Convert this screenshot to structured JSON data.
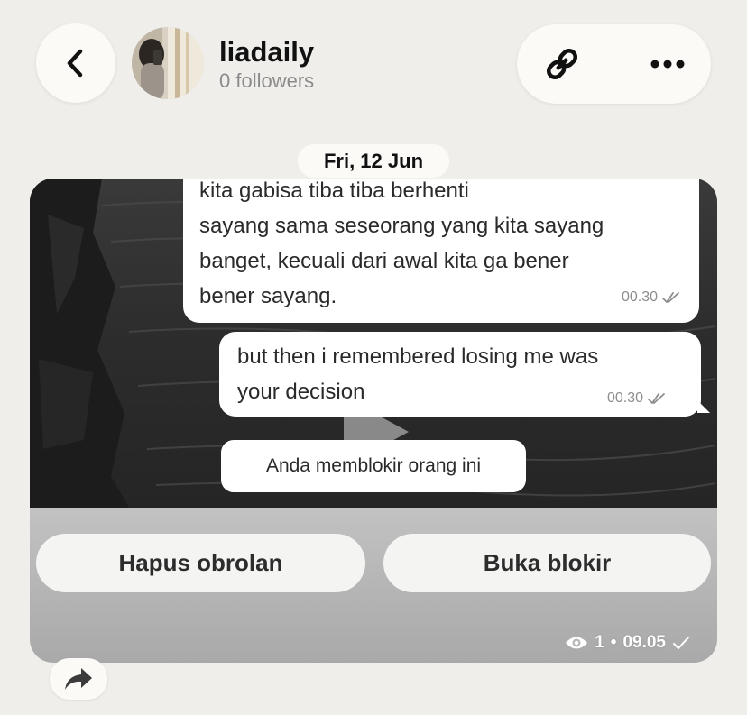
{
  "header": {
    "channel_name": "liadaily",
    "followers": "0 followers"
  },
  "icons": {
    "back": "chevron-left-icon",
    "link": "link-icon",
    "more": "more-horizontal-icon",
    "play": "play-icon",
    "views": "eye-icon",
    "sent": "check-icon",
    "read": "double-check-icon",
    "share": "share-arrow-icon"
  },
  "date_divider": "Fri, 12 Jun",
  "post": {
    "messages": [
      {
        "lines": [
          "kita gabisa tiba tiba berhenti",
          "sayang sama seseorang yang kita sayang",
          "banget, kecuali dari awal kita ga bener",
          "bener sayang."
        ],
        "time": "00.30"
      },
      {
        "lines": [
          "but then i remembered losing me was",
          "your decision"
        ],
        "time": "00.30"
      }
    ],
    "blocked_notice": "Anda memblokir orang ini",
    "buttons": {
      "delete_chat": "Hapus obrolan",
      "unblock": "Buka blokir"
    },
    "meta": {
      "views": "1",
      "separator": "•",
      "time": "09.05"
    }
  },
  "colors": {
    "background": "#efeeeb",
    "surface": "#fbfaf7",
    "muted_text": "#8b8b8b"
  }
}
